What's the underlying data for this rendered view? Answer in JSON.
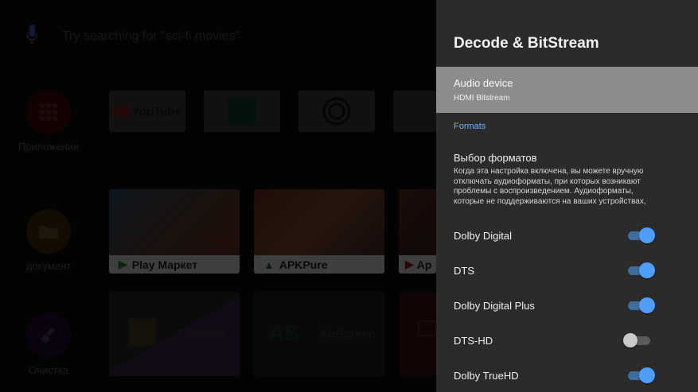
{
  "search": {
    "placeholder": "Try searching for \"sci-fi movies\""
  },
  "sidebar": [
    {
      "label": "Приложения",
      "icon": "apps-grid-icon",
      "color": "#d21d1d"
    },
    {
      "label": "документ",
      "icon": "folder-icon",
      "color": "#e8a11b"
    },
    {
      "label": "Очистка",
      "icon": "broom-icon",
      "color": "#7a2bbf"
    }
  ],
  "favorites": [
    {
      "label": "YouTube"
    }
  ],
  "app_cards": [
    {
      "label": "Play Маркет"
    },
    {
      "label": "APKPure"
    },
    {
      "label": "Ap"
    }
  ],
  "bottom_cards": [
    {
      "label": "Галерея"
    },
    {
      "label": "AirScreen"
    }
  ],
  "panel": {
    "title": "Decode & BitStream",
    "audio_device": {
      "title": "Audio device",
      "value": "HDMI Bitstream"
    },
    "section": "Formats",
    "format_select": {
      "title": "Выбор форматов",
      "description": "Когда эта настройка включена, вы можете вручную отключать аудиоформаты, при которых возникают проблемы с воспроизведением. Аудиоформаты, которые не поддерживаются на ваших устройствах,"
    },
    "formats": [
      {
        "name": "Dolby Digital",
        "enabled": true
      },
      {
        "name": "DTS",
        "enabled": true
      },
      {
        "name": "Dolby Digital Plus",
        "enabled": true
      },
      {
        "name": "DTS-HD",
        "enabled": false
      },
      {
        "name": "Dolby TrueHD",
        "enabled": true
      }
    ]
  },
  "colors": {
    "accent": "#4f9dff",
    "panel_bg": "#2b2b2b",
    "selected_bg": "#8c8c8c"
  }
}
